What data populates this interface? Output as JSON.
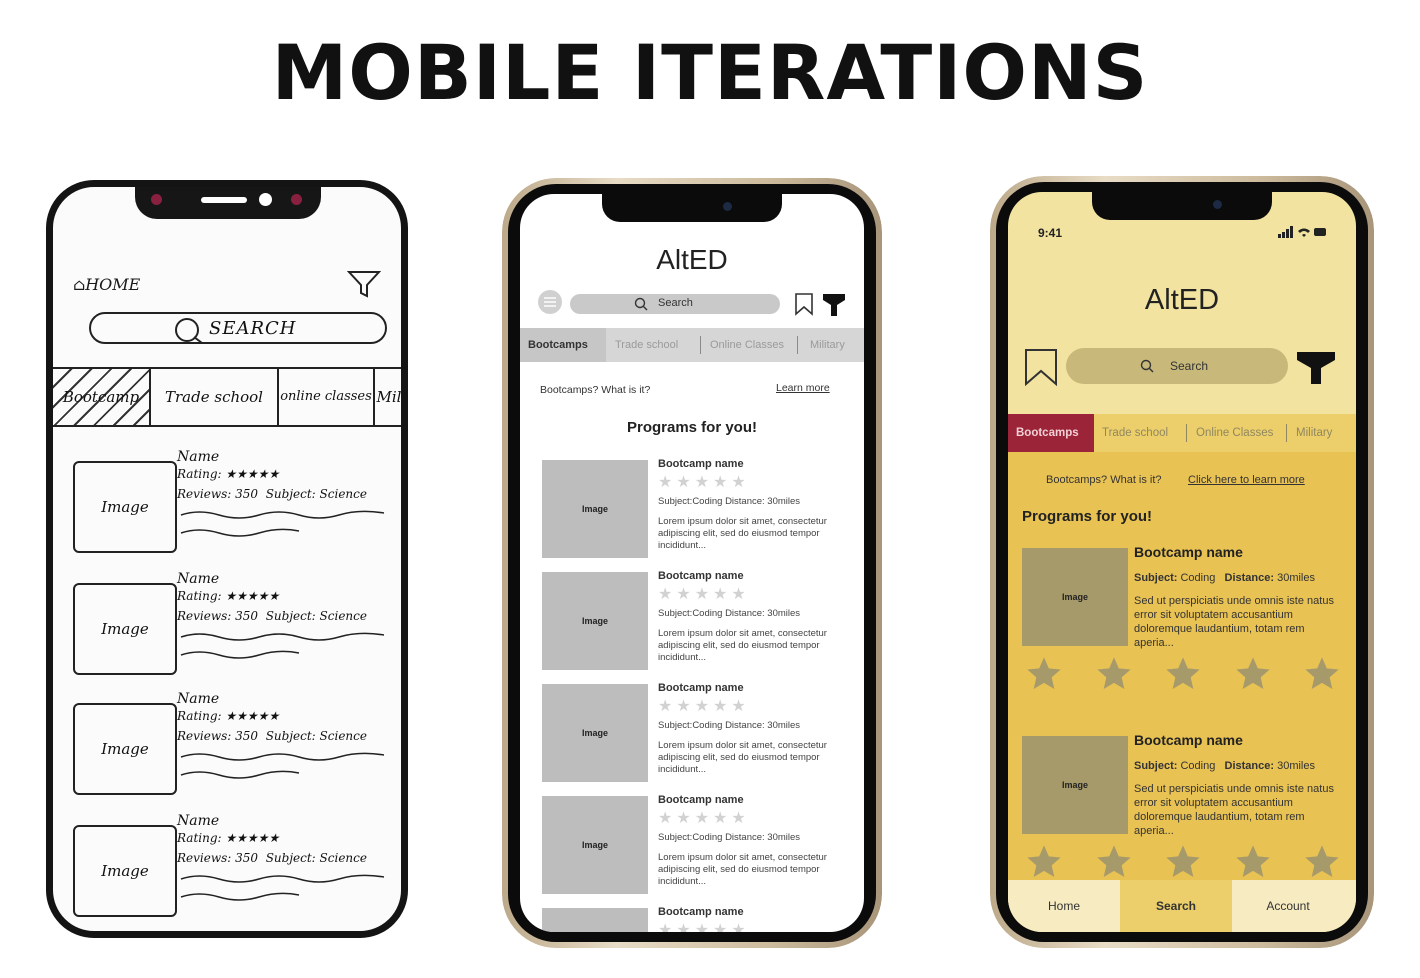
{
  "page_title": "MOBILE ITERATIONS",
  "sketch": {
    "home": "HOME",
    "search": "SEARCH",
    "tabs": [
      "Bootcamp",
      "Trade school",
      "online classes",
      "Mil"
    ],
    "card": {
      "name": "Name",
      "rating": "Rating:",
      "reviews": "Reviews: 350",
      "subject": "Subject: Science",
      "image": "Image"
    }
  },
  "lowfi": {
    "title": "AltED",
    "search_placeholder": "Search",
    "tabs": [
      "Bootcamps",
      "Trade school",
      "Online Classes",
      "Military"
    ],
    "info": "Bootcamps? What is it?",
    "learn_more": "Learn more",
    "heading": "Programs for you!",
    "cards": [
      {
        "name": "Bootcamp name",
        "image": "Image",
        "meta": "Subject:Coding    Distance: 30miles",
        "desc": "Lorem ipsum dolor sit amet, consectetur adipiscing elit, sed do eiusmod tempor incididunt..."
      },
      {
        "name": "Bootcamp name",
        "image": "Image",
        "meta": "Subject:Coding    Distance: 30miles",
        "desc": "Lorem ipsum dolor sit amet, consectetur adipiscing elit, sed do eiusmod tempor incididunt..."
      },
      {
        "name": "Bootcamp name",
        "image": "Image",
        "meta": "Subject:Coding    Distance: 30miles",
        "desc": "Lorem ipsum dolor sit amet, consectetur adipiscing elit, sed do eiusmod tempor incididunt..."
      },
      {
        "name": "Bootcamp name",
        "image": "Image",
        "meta": "Subject:Coding    Distance: 30miles",
        "desc": "Lorem ipsum dolor sit amet, consectetur adipiscing elit, sed do eiusmod tempor incididunt..."
      },
      {
        "name": "Bootcamp name"
      }
    ],
    "stars": "★★★★★"
  },
  "hifi": {
    "time": "9:41",
    "title": "AltED",
    "search_placeholder": "Search",
    "tabs": [
      "Bootcamps",
      "Trade school",
      "Online Classes",
      "Military"
    ],
    "info": "Bootcamps? What is it?",
    "learn_more": "Click here to learn more",
    "heading": "Programs for you!",
    "cards": [
      {
        "name": "Bootcamp name",
        "image": "Image",
        "subject_label": "Subject:",
        "subject": "Coding",
        "distance_label": "Distance:",
        "distance": "30miles",
        "desc": "Sed ut perspiciatis unde omnis iste natus error sit voluptatem accusantium doloremque laudantium, totam rem aperia..."
      },
      {
        "name": "Bootcamp name",
        "image": "Image",
        "subject_label": "Subject:",
        "subject": "Coding",
        "distance_label": "Distance:",
        "distance": "30miles",
        "desc": "Sed ut perspiciatis unde omnis iste natus error sit voluptatem accusantium doloremque laudantium, totam rem aperia..."
      }
    ],
    "nav": [
      "Home",
      "Search",
      "Account"
    ],
    "colors": {
      "screen": "#f2e3a0",
      "body": "#e9c254",
      "active_tab": "#9b2438",
      "image": "#a79a6a"
    }
  }
}
